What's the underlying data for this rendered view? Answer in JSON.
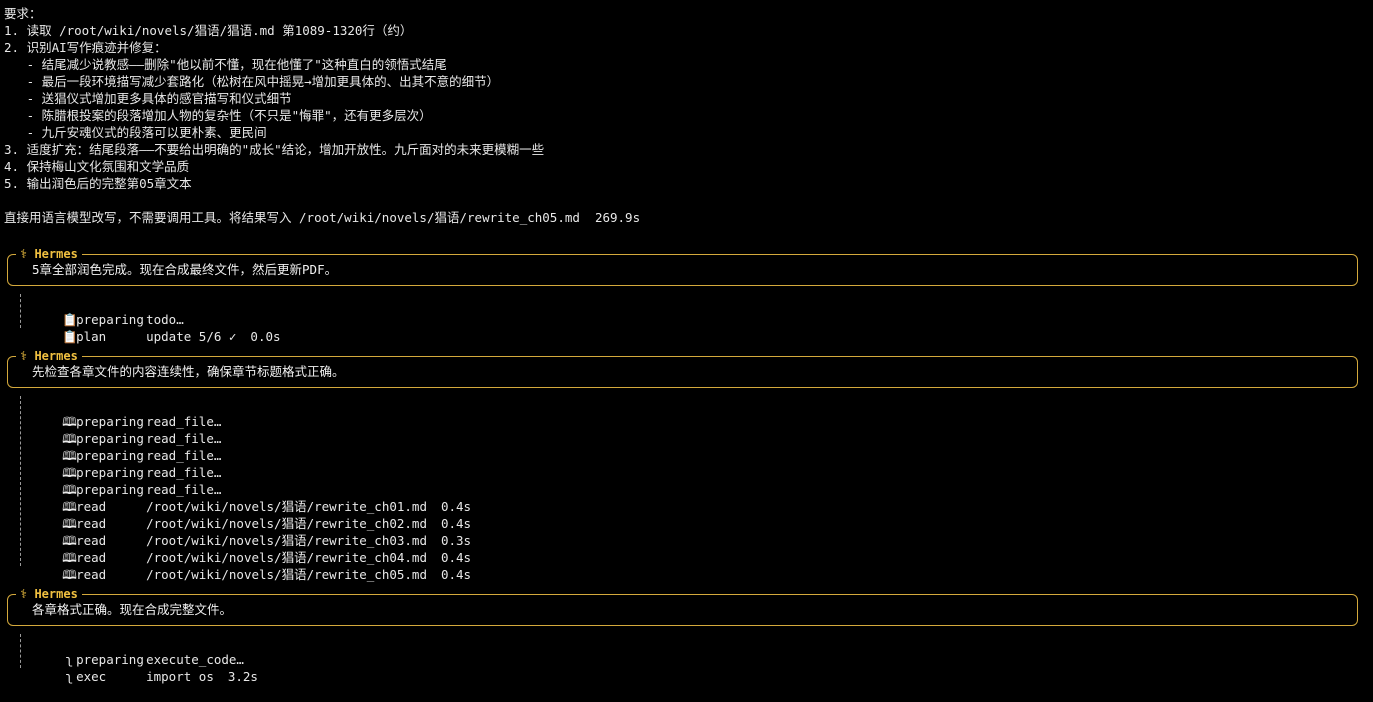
{
  "requirements": {
    "heading": "要求：",
    "items": [
      "1. 读取 /root/wiki/novels/猖语/猖语.md 第1089-1320行（约）",
      "2. 识别AI写作痕迹并修复：",
      "   - 结尾减少说教感——删除\"他以前不懂，现在他懂了\"这种直白的领悟式结尾",
      "   - 最后一段环境描写减少套路化（松树在风中摇晃→增加更具体的、出其不意的细节）",
      "   - 送猖仪式增加更多具体的感官描写和仪式细节",
      "   - 陈腊根投案的段落增加人物的复杂性（不只是\"悔罪\"，还有更多层次）",
      "   - 九斤安魂仪式的段落可以更朴素、更民间",
      "3. 适度扩充：结尾段落——不要给出明确的\"成长\"结论，增加开放性。九斤面对的未来更模糊一些",
      "4. 保持梅山文化氛围和文学品质",
      "5. 输出润色后的完整第05章文本"
    ],
    "instruction": "直接用语言模型改写，不需要调用工具。将结果写入 /root/wiki/novels/猖语/rewrite_ch05.md  269.9s"
  },
  "hermes_label": "⚕ Hermes",
  "blocks": [
    {
      "message": "5章全部润色完成。现在合成最终文件，然后更新PDF。",
      "tools": [
        {
          "icon": "clipboard-icon",
          "glyph": "📋",
          "verb": "preparing",
          "arg": "todo…",
          "dur": ""
        },
        {
          "icon": "clipboard-icon",
          "glyph": "📋",
          "verb": "plan",
          "arg": "update 5/6 ✓",
          "dur": "0.0s"
        }
      ]
    },
    {
      "message": "先检查各章文件的内容连续性，确保章节标题格式正确。",
      "tools": [
        {
          "icon": "book-icon",
          "glyph": "🕮",
          "verb": "preparing",
          "arg": "read_file…",
          "dur": ""
        },
        {
          "icon": "book-icon",
          "glyph": "🕮",
          "verb": "preparing",
          "arg": "read_file…",
          "dur": ""
        },
        {
          "icon": "book-icon",
          "glyph": "🕮",
          "verb": "preparing",
          "arg": "read_file…",
          "dur": ""
        },
        {
          "icon": "book-icon",
          "glyph": "🕮",
          "verb": "preparing",
          "arg": "read_file…",
          "dur": ""
        },
        {
          "icon": "book-icon",
          "glyph": "🕮",
          "verb": "preparing",
          "arg": "read_file…",
          "dur": ""
        },
        {
          "icon": "book-icon",
          "glyph": "🕮",
          "verb": "read",
          "arg": "/root/wiki/novels/猖语/rewrite_ch01.md",
          "dur": "0.4s"
        },
        {
          "icon": "book-icon",
          "glyph": "🕮",
          "verb": "read",
          "arg": "/root/wiki/novels/猖语/rewrite_ch02.md",
          "dur": "0.4s"
        },
        {
          "icon": "book-icon",
          "glyph": "🕮",
          "verb": "read",
          "arg": "/root/wiki/novels/猖语/rewrite_ch03.md",
          "dur": "0.3s"
        },
        {
          "icon": "book-icon",
          "glyph": "🕮",
          "verb": "read",
          "arg": "/root/wiki/novels/猖语/rewrite_ch04.md",
          "dur": "0.4s"
        },
        {
          "icon": "book-icon",
          "glyph": "🕮",
          "verb": "read",
          "arg": "/root/wiki/novels/猖语/rewrite_ch05.md",
          "dur": "0.4s"
        }
      ]
    },
    {
      "message": "各章格式正确。现在合成完整文件。",
      "tools": [
        {
          "icon": "snake-icon",
          "glyph": "ʅ",
          "verb": "preparing",
          "arg": "execute_code…",
          "dur": ""
        },
        {
          "icon": "snake-icon",
          "glyph": "ʅ",
          "verb": "exec",
          "arg": "import os",
          "dur": "3.2s"
        }
      ]
    }
  ],
  "colors": {
    "background": "#000000",
    "text": "#e8e8e8",
    "hermes_border": "#d4a93c",
    "hermes_label": "#f0c040"
  }
}
